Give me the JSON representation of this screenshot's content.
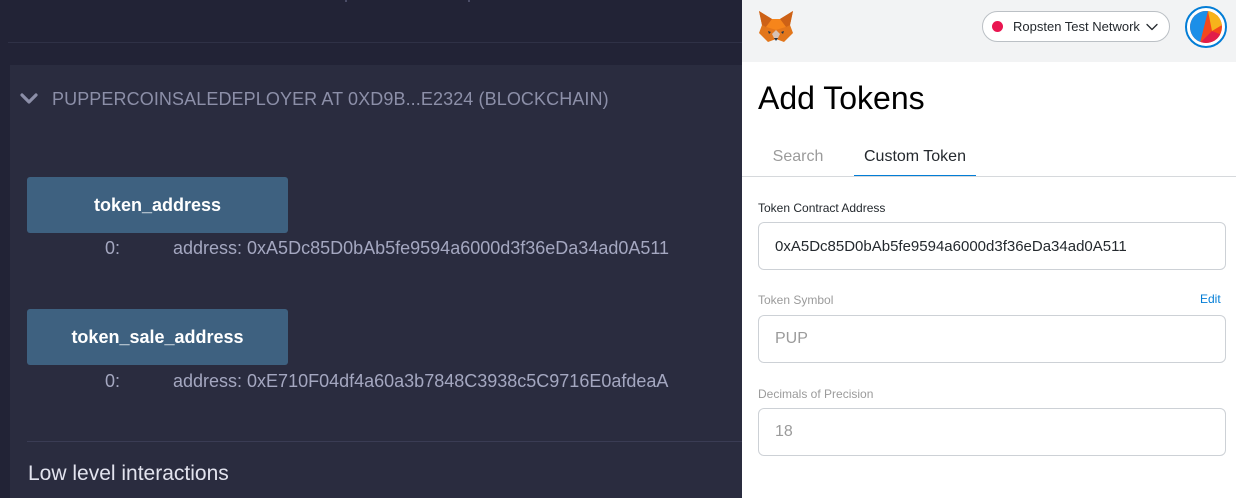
{
  "remix": {
    "contract_title": "PUPPERCOINSALEDEPLOYER AT 0XD9B...E2324 (BLOCKCHAIN)",
    "functions": [
      {
        "label": "token_address",
        "result_index": "0:",
        "result_value": "address: 0xA5Dc85D0bAb5fe9594a6000d3f36eDa34ad0A511"
      },
      {
        "label": "token_sale_address",
        "result_index": "0:",
        "result_value": "address: 0xE710F04df4a60a3b7848C3938c5C9716E0afdeaA"
      }
    ],
    "low_level_heading": "Low level interactions"
  },
  "metamask": {
    "network": {
      "label": "Ropsten Test Network",
      "dot_color": "#e91550"
    },
    "page_title": "Add Tokens",
    "tabs": [
      {
        "label": "Search",
        "active": false
      },
      {
        "label": "Custom Token",
        "active": true
      }
    ],
    "fields": {
      "contract_address": {
        "label": "Token Contract Address",
        "value": "0xA5Dc85D0bAb5fe9594a6000d3f36eDa34ad0A511"
      },
      "symbol": {
        "label": "Token Symbol",
        "value": "PUP",
        "edit_label": "Edit"
      },
      "decimals": {
        "label": "Decimals of Precision",
        "value": "18"
      }
    },
    "icons": [
      "metamask-fox-icon",
      "chevron-down-icon",
      "account-avatar"
    ]
  },
  "colors": {
    "remix_bg": "#222336",
    "remix_panel": "#2a2c3f",
    "remix_button": "#3e6180",
    "metamask_accent": "#037dd6"
  }
}
